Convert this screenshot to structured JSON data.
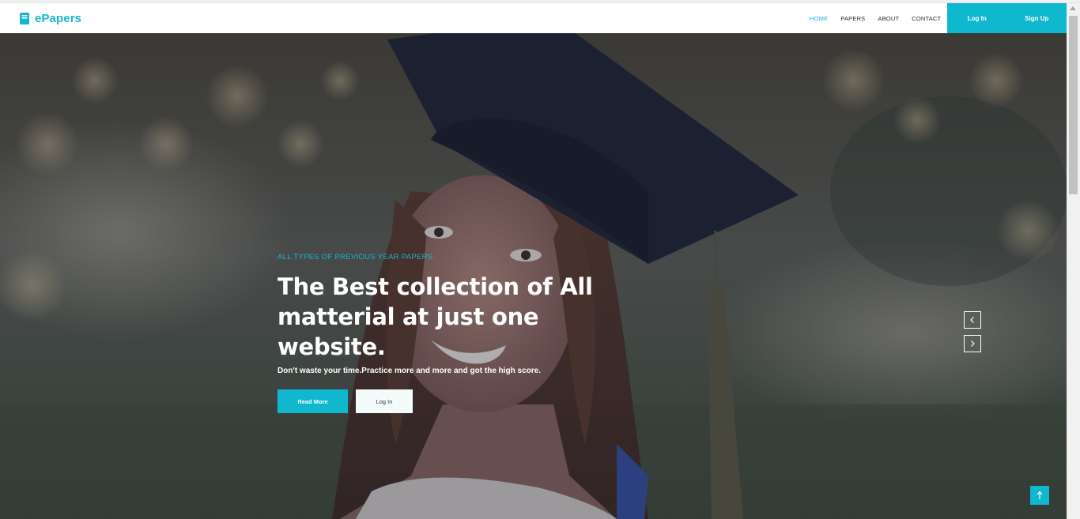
{
  "brand": {
    "name": "ePapers",
    "icon": "book-icon",
    "color": "#17b6ce"
  },
  "nav": {
    "links": [
      {
        "label": "HOME",
        "active": true
      },
      {
        "label": "PAPERS",
        "active": false
      },
      {
        "label": "ABOUT",
        "active": false
      },
      {
        "label": "CONTACT",
        "active": false
      }
    ],
    "login_label": "Log In",
    "signup_label": "Sign Up"
  },
  "hero": {
    "eyebrow": "ALL TYPES OF PREVIOUS YEAR PAPERS.",
    "headline_line1": "The Best collection of All",
    "headline_line2": "matterial at just one",
    "headline_line3": "website.",
    "subline": "Don't waste your time.Practice more and more and got the high score.",
    "primary_button": "Read More",
    "secondary_button": "Log In",
    "background": "graduate-photo"
  },
  "controls": {
    "prev_icon": "chevron-left-icon",
    "next_icon": "chevron-right-icon",
    "back_to_top_icon": "arrow-up-icon"
  },
  "colors": {
    "accent": "#0fb8ce",
    "text": "#ffffff"
  }
}
